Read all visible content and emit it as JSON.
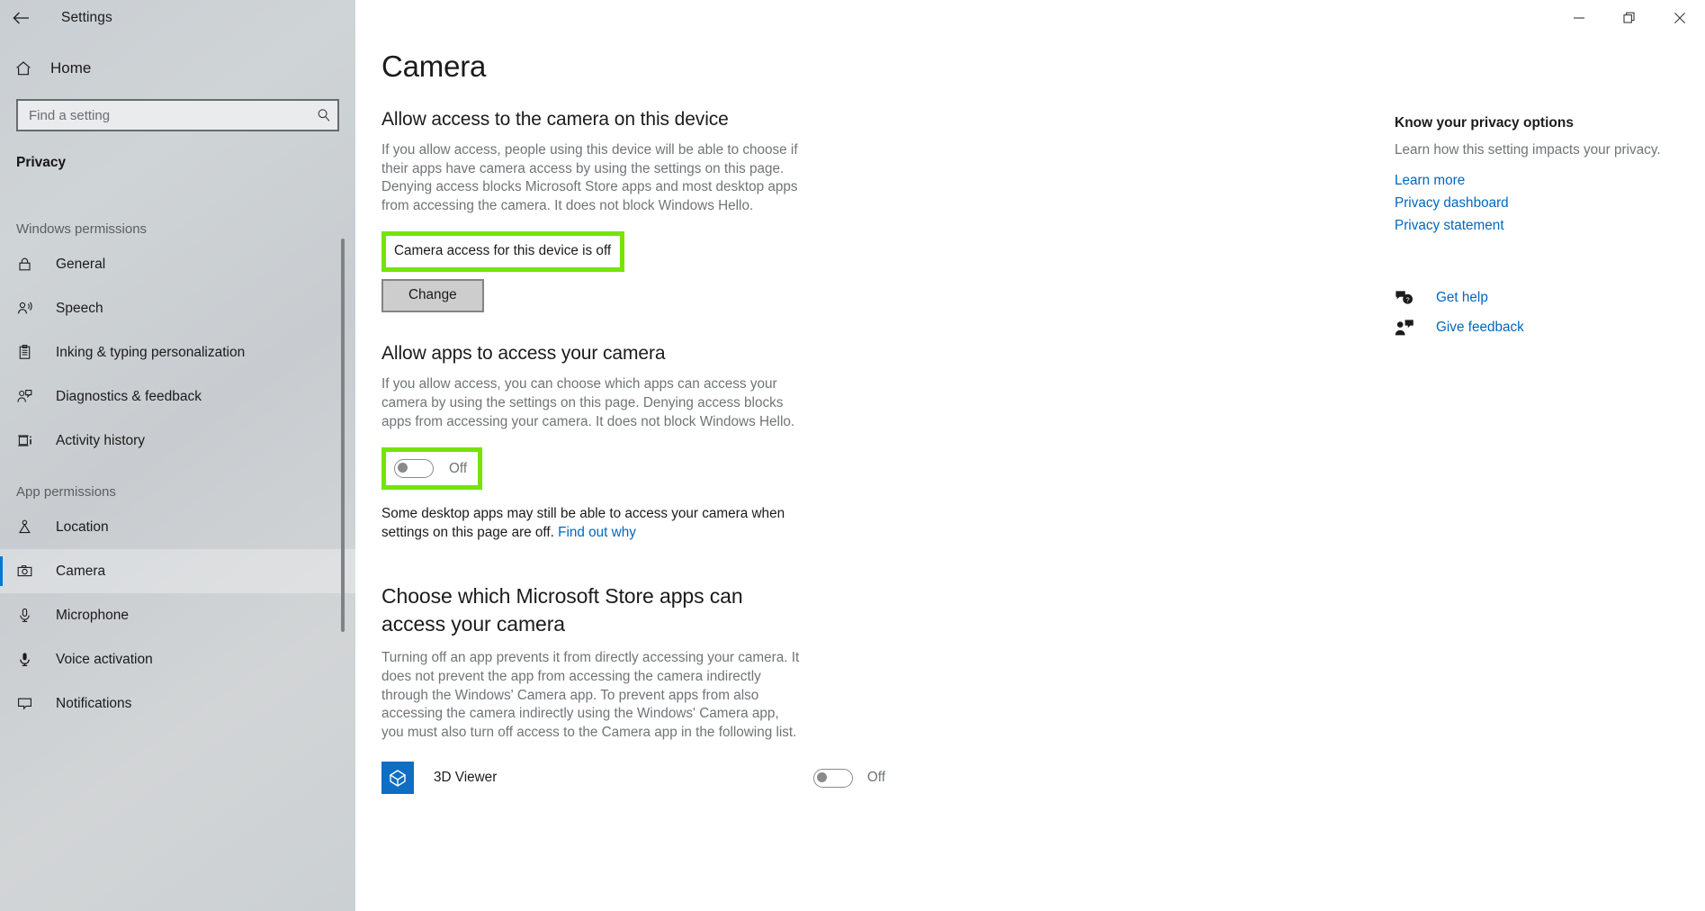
{
  "window": {
    "app_title": "Settings",
    "back_icon": "back-arrow-icon",
    "minimize_label": "—",
    "restore_label": "❐",
    "close_label": "✕"
  },
  "sidebar": {
    "home_label": "Home",
    "home_icon": "home-icon",
    "search": {
      "placeholder": "Find a setting",
      "value": "",
      "icon": "search-icon"
    },
    "category": "Privacy",
    "groups": [
      {
        "title": "Windows permissions",
        "items": [
          {
            "label": "General",
            "icon": "lock-icon",
            "selected": false
          },
          {
            "label": "Speech",
            "icon": "speech-person-icon",
            "selected": false
          },
          {
            "label": "Inking & typing personalization",
            "icon": "clipboard-icon",
            "selected": false
          },
          {
            "label": "Diagnostics & feedback",
            "icon": "person-feedback-icon",
            "selected": false
          },
          {
            "label": "Activity history",
            "icon": "activity-history-icon",
            "selected": false
          }
        ]
      },
      {
        "title": "App permissions",
        "items": [
          {
            "label": "Location",
            "icon": "location-pin-icon",
            "selected": false
          },
          {
            "label": "Camera",
            "icon": "camera-icon",
            "selected": true
          },
          {
            "label": "Microphone",
            "icon": "microphone-icon",
            "selected": false
          },
          {
            "label": "Voice activation",
            "icon": "voice-activation-icon",
            "selected": false
          },
          {
            "label": "Notifications",
            "icon": "notification-icon",
            "selected": false
          }
        ]
      }
    ]
  },
  "main": {
    "page_title": "Camera",
    "device_section": {
      "heading": "Allow access to the camera on this device",
      "description": "If you allow access, people using this device will be able to choose if their apps have camera access by using the settings on this page. Denying access blocks Microsoft Store apps and most desktop apps from accessing the camera. It does not block Windows Hello.",
      "status": "Camera access for this device is off",
      "status_highlighted": true,
      "change_button": "Change"
    },
    "apps_section": {
      "heading": "Allow apps to access your camera",
      "description": "If you allow access, you can choose which apps can access your camera by using the settings on this page. Denying access blocks apps from accessing your camera. It does not block Windows Hello.",
      "toggle_state": "Off",
      "toggle_highlighted": true,
      "note_text": "Some desktop apps may still be able to access your camera when settings on this page are off.",
      "note_link": "Find out why"
    },
    "store_apps_section": {
      "heading": "Choose which Microsoft Store apps can access your camera",
      "description": "Turning off an app prevents it from directly accessing your camera. It does not prevent the app from accessing the camera indirectly through the Windows' Camera app. To prevent apps from also accessing the camera indirectly using the Windows' Camera app, you must also turn off access to the Camera app in the following list.",
      "apps": [
        {
          "name": "3D Viewer",
          "icon": "3d-viewer-app-icon",
          "toggle_state": "Off"
        }
      ]
    }
  },
  "rail": {
    "heading": "Know your privacy options",
    "text": "Learn how this setting impacts your privacy.",
    "links": [
      {
        "label": "Learn more"
      },
      {
        "label": "Privacy dashboard"
      },
      {
        "label": "Privacy statement"
      }
    ],
    "actions": [
      {
        "label": "Get help",
        "icon": "get-help-icon"
      },
      {
        "label": "Give feedback",
        "icon": "give-feedback-icon"
      }
    ]
  },
  "colors": {
    "accent": "#0078d4",
    "link": "#0067c0",
    "highlight": "#76e300",
    "sidebar_bg": "#cdd2d5",
    "app_icon": "#0d6ec4"
  }
}
